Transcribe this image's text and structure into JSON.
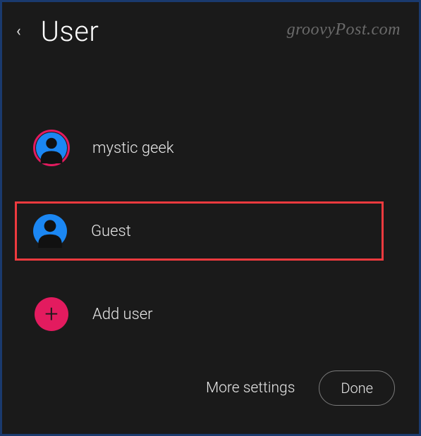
{
  "header": {
    "title": "User"
  },
  "watermark": "groovyPost.com",
  "users": [
    {
      "label": "mystic geek"
    },
    {
      "label": "Guest"
    },
    {
      "label": "Add user"
    }
  ],
  "footer": {
    "more_settings": "More settings",
    "done": "Done"
  },
  "colors": {
    "accent_pink": "#e31b5f",
    "accent_blue": "#1b87f3",
    "highlight_red": "#ee3a3e"
  }
}
